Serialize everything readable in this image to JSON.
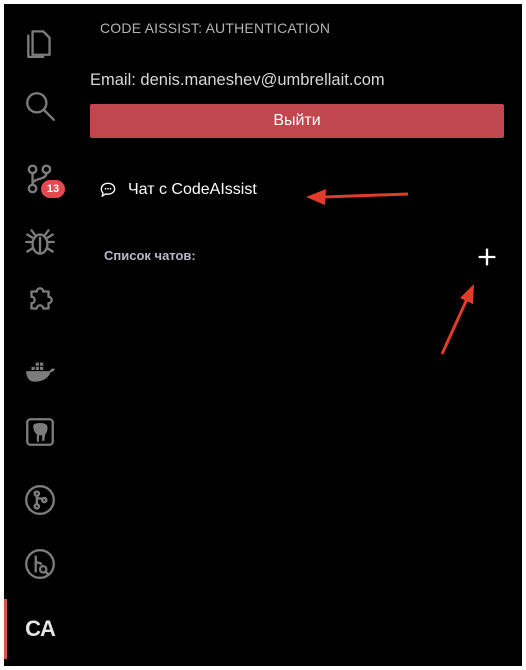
{
  "activity_bar": {
    "items": [
      {
        "icon": "files-icon"
      },
      {
        "icon": "search-icon"
      },
      {
        "icon": "source-control-icon",
        "badge": "13"
      },
      {
        "icon": "debug-icon"
      },
      {
        "icon": "extensions-icon"
      },
      {
        "icon": "docker-icon"
      },
      {
        "icon": "postgres-icon"
      },
      {
        "icon": "git-graph-icon"
      },
      {
        "icon": "git-lens-icon"
      },
      {
        "icon": "code-assist-icon",
        "label": "CA",
        "active": true
      }
    ]
  },
  "panel": {
    "title": "CODE AISSIST: AUTHENTICATION",
    "email": "Email: denis.maneshev@umbrellait.com",
    "logout_label": "Выйти",
    "chat_item": {
      "icon": "chat-bubble-icon",
      "label": "Чат с CodeAIssist"
    },
    "chat_list_label": "Список чатов:",
    "add_chat_label": "+"
  },
  "colors": {
    "background": "#000000",
    "accent_button": "#c0474e",
    "badge": "#e5484d",
    "annotation_arrow": "#e03c2a"
  }
}
